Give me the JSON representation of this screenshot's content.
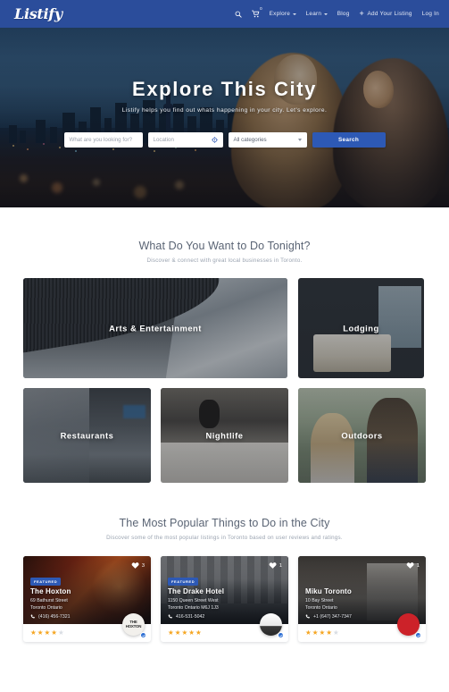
{
  "nav": {
    "brand": "Listify",
    "search_icon": "search-icon",
    "cart_icon": "cart-icon",
    "cart_count": "0",
    "items": [
      {
        "label": "Explore",
        "has_caret": true
      },
      {
        "label": "Learn",
        "has_caret": true
      },
      {
        "label": "Blog",
        "has_caret": false
      },
      {
        "label": "Add Your Listing",
        "has_caret": false,
        "plus": "+"
      },
      {
        "label": "Log In",
        "has_caret": false
      }
    ]
  },
  "hero": {
    "title": "Explore This City",
    "subtitle": "Listify helps you find out whats happening in your city. Let's explore.",
    "search": {
      "keyword_placeholder": "What are you looking for?",
      "keyword_value": "",
      "location_placeholder": "Location",
      "location_value": "",
      "locate_icon": "crosshair-icon",
      "category_selected": "All categories",
      "category_options": [
        "All categories"
      ],
      "submit_label": "Search"
    }
  },
  "categories_section": {
    "title": "What Do You Want to Do Tonight?",
    "subtitle": "Discover & connect with great local businesses in Toronto.",
    "tiles": [
      {
        "label": "Arts & Entertainment",
        "art": "art-arts"
      },
      {
        "label": "Lodging",
        "art": "art-lodging"
      },
      {
        "label": "Restaurants",
        "art": "art-rest"
      },
      {
        "label": "Nightlife",
        "art": "art-night"
      },
      {
        "label": "Outdoors",
        "art": "art-out"
      }
    ]
  },
  "popular_section": {
    "title": "The Most Popular Things to Do in the City",
    "subtitle": "Discover some of the most popular listings in Toronto based on user reviews and ratings.",
    "badge_label": "FEATURED",
    "phone_icon": "phone-icon",
    "heart_icon": "heart-icon",
    "verified_icon": "verified-check-icon",
    "cards": [
      {
        "title": "The Hoxton",
        "address_line1": "69 Bathurst Street",
        "address_line2": "Toronto Ontario",
        "phone": "(416) 456-7321",
        "favorites": "3",
        "rating": 3.5,
        "featured": true,
        "logo_text": "THE HOXTON",
        "logo_class": "lb-hoxton"
      },
      {
        "title": "The Drake Hotel",
        "address_line1": "1150 Queen Street West",
        "address_line2": "Toronto Ontario M6J 1J3",
        "phone": "416-531-5042",
        "favorites": "1",
        "rating": 4.5,
        "featured": true,
        "logo_text": "",
        "logo_class": "lb-drake"
      },
      {
        "title": "Miku Toronto",
        "address_line1": "10 Bay Street",
        "address_line2": "Toronto Ontario",
        "phone": "+1 (647) 347-7347",
        "favorites": "1",
        "rating": 4,
        "featured": false,
        "logo_text": "",
        "logo_class": "lb-miku"
      }
    ]
  },
  "colors": {
    "brand_blue": "#2b4d9b",
    "button_blue": "#2d59b5",
    "star_gold": "#f5a623",
    "heading_gray": "#5a6474",
    "verified_blue": "#2d6fd4"
  }
}
